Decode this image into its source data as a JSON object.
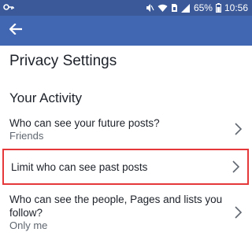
{
  "status_bar": {
    "left_icon": "key-icon",
    "right_icons": [
      "mute-icon",
      "wifi-icon",
      "sim-icon",
      "signal-icon"
    ],
    "battery": "65%",
    "time": "10:56"
  },
  "app_bar": {
    "back_icon": "back-arrow-icon",
    "bg": "#4267b2"
  },
  "page": {
    "title": "Privacy Settings"
  },
  "section": {
    "title": "Your Activity"
  },
  "rows": [
    {
      "title": "Who can see your future posts?",
      "value": "Friends"
    },
    {
      "title": "Limit who can see past posts",
      "highlight": "#e5383b"
    },
    {
      "title": "Who can see the people, Pages and lists you follow?",
      "value": "Only me"
    }
  ]
}
